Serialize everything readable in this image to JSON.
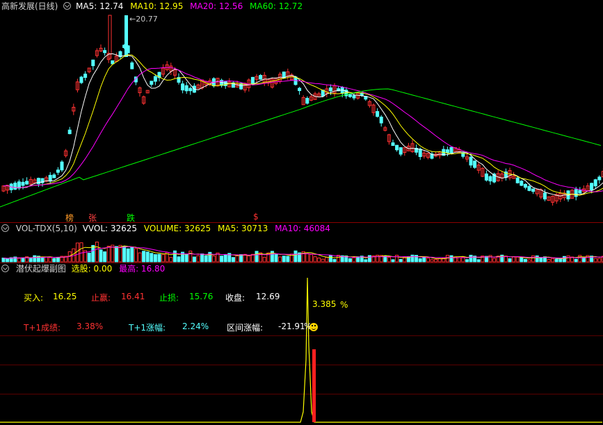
{
  "main": {
    "title": "高新发展(日线)",
    "ma5": "MA5: 12.74",
    "ma10": "MA10: 12.95",
    "ma20": "MA20: 12.56",
    "ma60": "MA60: 12.72",
    "peak_label": "20.77",
    "markers": [
      "榜",
      "张",
      "跌",
      "$"
    ],
    "colors": {
      "up": "#ff3232",
      "down": "#54ffff",
      "ma5": "#ffffff",
      "ma10": "#ffff00",
      "ma20": "#ff00ff",
      "ma60": "#00ff00"
    }
  },
  "volume": {
    "title": "VOL-TDX(5,10)",
    "vvol": "VVOL: 32625",
    "volume": "VOLUME: 32625",
    "ma5": "MA5: 30713",
    "ma10": "MA10: 46084"
  },
  "sub": {
    "title": "潜伏起爆副图",
    "xuangu": "选股: 0.00",
    "zuigao": "最高: 16.80",
    "buy_label": "买入:",
    "buy_value": "16.25",
    "take_profit_label": "止赢:",
    "take_profit_value": "16.41",
    "stop_loss_label": "止损:",
    "stop_loss_value": "15.76",
    "close_label": "收盘:",
    "close_value": "12.69",
    "t1_result_label": "T+1成绩:",
    "t1_result_value": "3.38%",
    "t1_rise_label": "T+1涨幅:",
    "t1_rise_value": "2.24%",
    "range_label": "区间涨幅:",
    "range_value": "-21.91",
    "spike_label": "3.385",
    "percent_sign": "%"
  }
}
